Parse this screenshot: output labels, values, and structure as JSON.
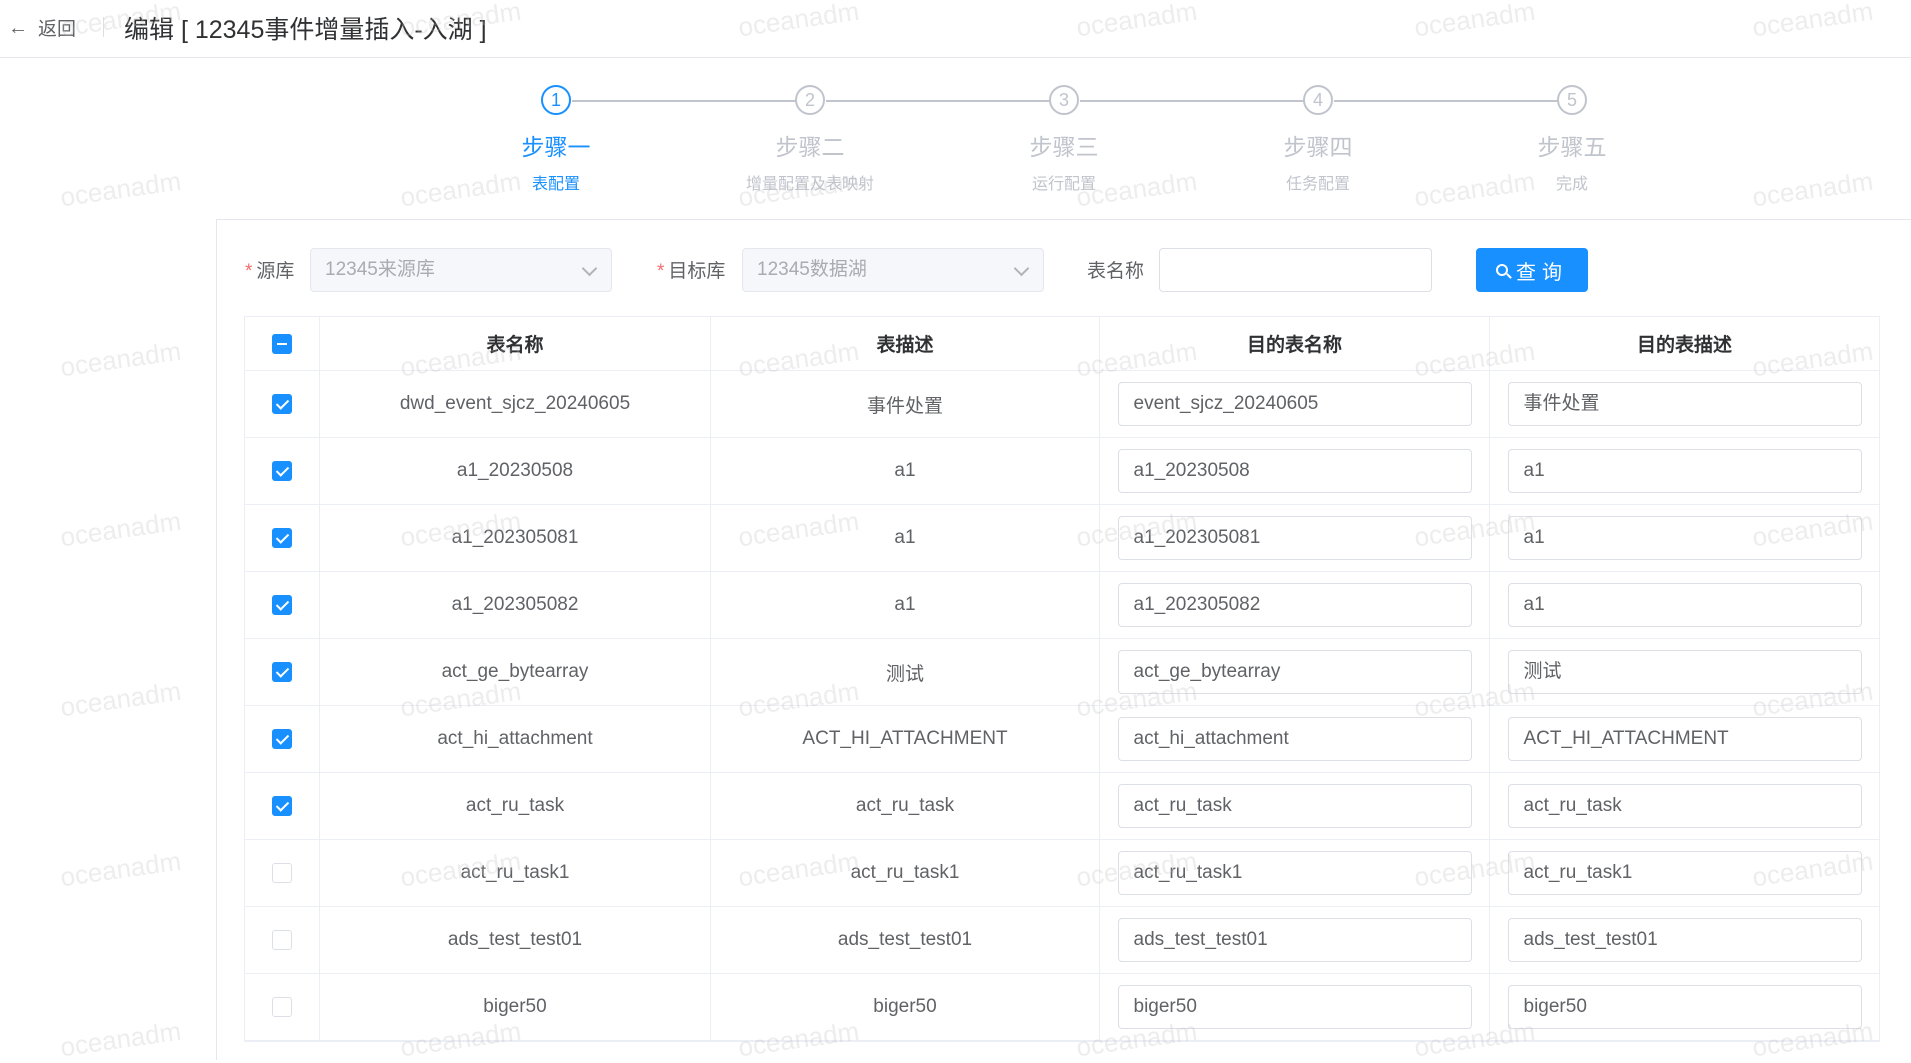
{
  "header": {
    "back_label": "返回",
    "title": "编辑 [ 12345事件增量插入-入湖 ]"
  },
  "steps": [
    {
      "number": "1",
      "title": "步骤一",
      "desc": "表配置",
      "active": true
    },
    {
      "number": "2",
      "title": "步骤二",
      "desc": "增量配置及表映射",
      "active": false
    },
    {
      "number": "3",
      "title": "步骤三",
      "desc": "运行配置",
      "active": false
    },
    {
      "number": "4",
      "title": "步骤四",
      "desc": "任务配置",
      "active": false
    },
    {
      "number": "5",
      "title": "步骤五",
      "desc": "完成",
      "active": false
    }
  ],
  "filters": {
    "source_label": "源库",
    "source_value": "12345来源库",
    "target_label": "目标库",
    "target_value": "12345数据湖",
    "table_name_label": "表名称",
    "table_name_value": "",
    "query_button": "查询"
  },
  "table": {
    "columns": [
      "表名称",
      "表描述",
      "目的表名称",
      "目的表描述"
    ],
    "rows": [
      {
        "checked": true,
        "name": "dwd_event_sjcz_20240605",
        "desc": "事件处置",
        "target_name": "event_sjcz_20240605",
        "target_desc": "事件处置"
      },
      {
        "checked": true,
        "name": "a1_20230508",
        "desc": "a1",
        "target_name": "a1_20230508",
        "target_desc": "a1"
      },
      {
        "checked": true,
        "name": "a1_202305081",
        "desc": "a1",
        "target_name": "a1_202305081",
        "target_desc": "a1"
      },
      {
        "checked": true,
        "name": "a1_202305082",
        "desc": "a1",
        "target_name": "a1_202305082",
        "target_desc": "a1"
      },
      {
        "checked": true,
        "name": "act_ge_bytearray",
        "desc": "测试",
        "target_name": "act_ge_bytearray",
        "target_desc": "测试"
      },
      {
        "checked": true,
        "name": "act_hi_attachment",
        "desc": "ACT_HI_ATTACHMENT",
        "target_name": "act_hi_attachment",
        "target_desc": "ACT_HI_ATTACHMENT"
      },
      {
        "checked": true,
        "name": "act_ru_task",
        "desc": "act_ru_task",
        "target_name": "act_ru_task",
        "target_desc": "act_ru_task"
      },
      {
        "checked": false,
        "name": "act_ru_task1",
        "desc": "act_ru_task1",
        "target_name": "act_ru_task1",
        "target_desc": "act_ru_task1"
      },
      {
        "checked": false,
        "name": "ads_test_test01",
        "desc": "ads_test_test01",
        "target_name": "ads_test_test01",
        "target_desc": "ads_test_test01"
      },
      {
        "checked": false,
        "name": "biger50",
        "desc": "biger50",
        "target_name": "biger50",
        "target_desc": "biger50"
      }
    ]
  },
  "watermark": "oceanadm",
  "colors": {
    "primary": "#1890ff",
    "required": "#f56c6c",
    "inactive": "#c0c4cc"
  }
}
